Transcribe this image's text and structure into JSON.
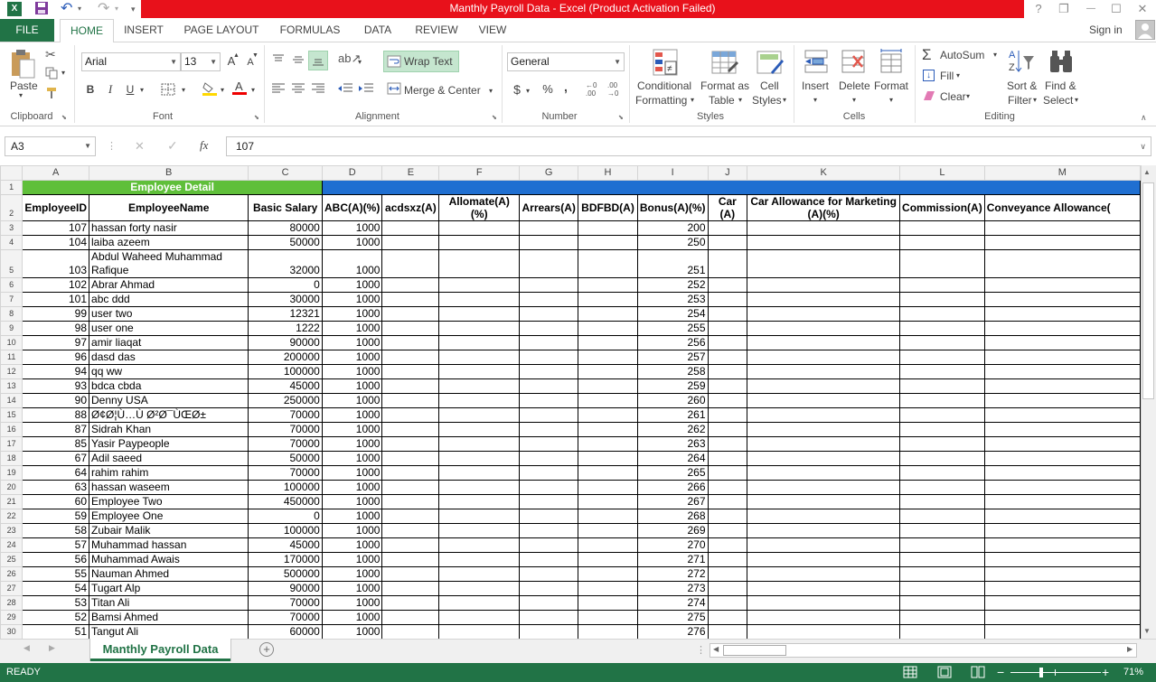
{
  "window": {
    "title": "Manthly Payroll Data -  Excel (Product Activation Failed)",
    "help": "?",
    "restore": "❐",
    "minimize": "—",
    "maximize": "☐",
    "close": "✕"
  },
  "qat": {
    "undo": "↶",
    "redo": "↷",
    "customize": "▾"
  },
  "tabs": [
    "FILE",
    "HOME",
    "INSERT",
    "PAGE LAYOUT",
    "FORMULAS",
    "DATA",
    "REVIEW",
    "VIEW"
  ],
  "account": {
    "signin": "Sign in"
  },
  "ribbon": {
    "clipboard": {
      "label": "Clipboard",
      "paste": "Paste"
    },
    "font": {
      "label": "Font",
      "name": "Arial",
      "size": "13",
      "bold": "B",
      "italic": "I",
      "underline": "U",
      "grow": "A",
      "shrink": "A"
    },
    "alignment": {
      "label": "Alignment",
      "wrap": "Wrap Text",
      "merge": "Merge & Center"
    },
    "number": {
      "label": "Number",
      "format": "General",
      "currency": "$",
      "percent": "%",
      "comma": ","
    },
    "styles": {
      "label": "Styles",
      "cond1": "Conditional",
      "cond2": "Formatting",
      "fmt1": "Format as",
      "fmt2": "Table",
      "cell1": "Cell",
      "cell2": "Styles"
    },
    "cells": {
      "label": "Cells",
      "insert": "Insert",
      "delete": "Delete",
      "format": "Format"
    },
    "editing": {
      "label": "Editing",
      "autosum": "AutoSum",
      "fill": "Fill",
      "clear": "Clear",
      "sort1": "Sort &",
      "sort2": "Filter",
      "find1": "Find &",
      "find2": "Select"
    }
  },
  "formula": {
    "namebox": "A3",
    "fx": "fx",
    "value": "107"
  },
  "columns": [
    "A",
    "B",
    "C",
    "D",
    "E",
    "F",
    "G",
    "H",
    "I",
    "J",
    "K",
    "L",
    "M"
  ],
  "header1": {
    "employee_detail": "Employee Detail"
  },
  "header2": [
    "EmployeeID",
    "EmployeeName",
    "Basic Salary",
    "ABC(A)(%)",
    "acdsxz(A)",
    "Allomate(A)(%)",
    "Arrears(A)",
    "BDFBD(A)",
    "Bonus(A)(%)",
    "Car (A)",
    "Car Allowance for Marketing (A)(%)",
    "Commission(A)",
    "Conveyance Allowance("
  ],
  "rows": [
    {
      "r": "3",
      "id": "107",
      "name": "hassan forty nasir",
      "salary": "80000",
      "abc": "1000",
      "bonus": "200"
    },
    {
      "r": "4",
      "id": "104",
      "name": "laiba azeem",
      "salary": "50000",
      "abc": "1000",
      "bonus": "250"
    },
    {
      "r": "5",
      "id": "103",
      "name": "Abdul Waheed Muhammad Rafique",
      "salary": "32000",
      "abc": "1000",
      "bonus": "251"
    },
    {
      "r": "6",
      "id": "102",
      "name": "Abrar Ahmad",
      "salary": "0",
      "abc": "1000",
      "bonus": "252"
    },
    {
      "r": "7",
      "id": "101",
      "name": "abc ddd",
      "salary": "30000",
      "abc": "1000",
      "bonus": "253"
    },
    {
      "r": "8",
      "id": "99",
      "name": "user two",
      "salary": "12321",
      "abc": "1000",
      "bonus": "254"
    },
    {
      "r": "9",
      "id": "98",
      "name": "user one",
      "salary": "1222",
      "abc": "1000",
      "bonus": "255"
    },
    {
      "r": "10",
      "id": "97",
      "name": "amir liaqat",
      "salary": "90000",
      "abc": "1000",
      "bonus": "256"
    },
    {
      "r": "11",
      "id": "96",
      "name": "dasd das",
      "salary": "200000",
      "abc": "1000",
      "bonus": "257"
    },
    {
      "r": "12",
      "id": "94",
      "name": "qq ww",
      "salary": "100000",
      "abc": "1000",
      "bonus": "258"
    },
    {
      "r": "13",
      "id": "93",
      "name": "bdca cbda",
      "salary": "45000",
      "abc": "1000",
      "bonus": "259"
    },
    {
      "r": "14",
      "id": "90",
      "name": "Denny USA",
      "salary": "250000",
      "abc": "1000",
      "bonus": "260"
    },
    {
      "r": "15",
      "id": "88",
      "name": "Ø¢Ø¦Ù…Ù Ø²Ø¯ÙŒØ±",
      "salary": "70000",
      "abc": "1000",
      "bonus": "261"
    },
    {
      "r": "16",
      "id": "87",
      "name": "Sidrah Khan",
      "salary": "70000",
      "abc": "1000",
      "bonus": "262"
    },
    {
      "r": "17",
      "id": "85",
      "name": "Yasir Paypeople",
      "salary": "70000",
      "abc": "1000",
      "bonus": "263"
    },
    {
      "r": "18",
      "id": "67",
      "name": "Adil saeed",
      "salary": "50000",
      "abc": "1000",
      "bonus": "264"
    },
    {
      "r": "19",
      "id": "64",
      "name": "rahim rahim",
      "salary": "70000",
      "abc": "1000",
      "bonus": "265"
    },
    {
      "r": "20",
      "id": "63",
      "name": "hassan waseem",
      "salary": "100000",
      "abc": "1000",
      "bonus": "266"
    },
    {
      "r": "21",
      "id": "60",
      "name": "Employee Two",
      "salary": "450000",
      "abc": "1000",
      "bonus": "267"
    },
    {
      "r": "22",
      "id": "59",
      "name": "Employee One",
      "salary": "0",
      "abc": "1000",
      "bonus": "268"
    },
    {
      "r": "23",
      "id": "58",
      "name": "Zubair Malik",
      "salary": "100000",
      "abc": "1000",
      "bonus": "269"
    },
    {
      "r": "24",
      "id": "57",
      "name": "Muhammad hassan",
      "salary": "45000",
      "abc": "1000",
      "bonus": "270"
    },
    {
      "r": "25",
      "id": "56",
      "name": "Muhammad Awais",
      "salary": "170000",
      "abc": "1000",
      "bonus": "271"
    },
    {
      "r": "26",
      "id": "55",
      "name": "Nauman Ahmed",
      "salary": "500000",
      "abc": "1000",
      "bonus": "272"
    },
    {
      "r": "27",
      "id": "54",
      "name": "Tugart Alp",
      "salary": "90000",
      "abc": "1000",
      "bonus": "273"
    },
    {
      "r": "28",
      "id": "53",
      "name": "Titan Ali",
      "salary": "70000",
      "abc": "1000",
      "bonus": "274"
    },
    {
      "r": "29",
      "id": "52",
      "name": "Bamsi Ahmed",
      "salary": "70000",
      "abc": "1000",
      "bonus": "275"
    },
    {
      "r": "30",
      "id": "51",
      "name": "Tangut Ali",
      "salary": "60000",
      "abc": "1000",
      "bonus": "276"
    }
  ],
  "sheet": {
    "tab": "Manthly Payroll Data",
    "add": "+"
  },
  "status": {
    "ready": "READY",
    "zoom": "71%"
  }
}
